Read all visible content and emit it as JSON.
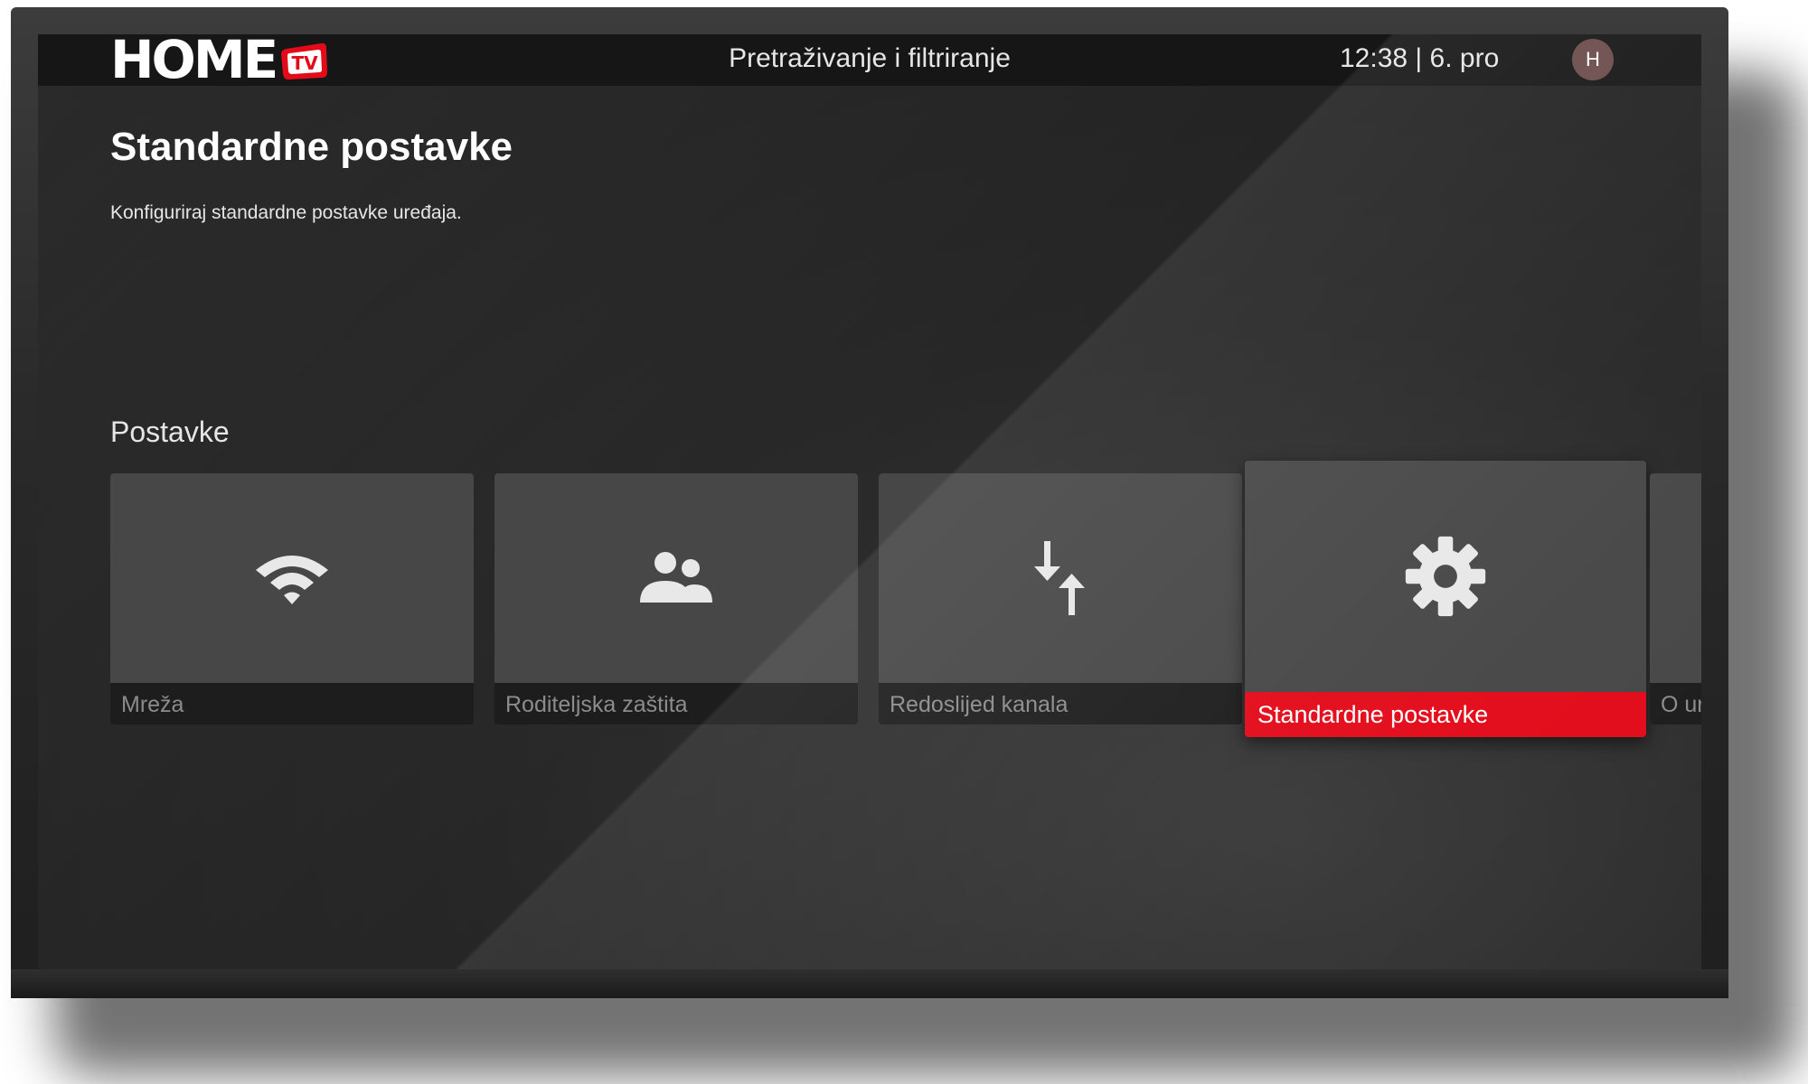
{
  "header": {
    "logo_text": "HOME",
    "logo_badge": "TV",
    "nav_title": "Pretraživanje i filtriranje",
    "clock": "12:38 | 6. pro",
    "avatar_initial": "H"
  },
  "page": {
    "title": "Standardne postavke",
    "subtitle": "Konfiguriraj standardne postavke uređaja."
  },
  "settings": {
    "section_title": "Postavke",
    "tiles": [
      {
        "label": "Mreža",
        "icon": "wifi-icon"
      },
      {
        "label": "Roditeljska zaštita",
        "icon": "people-icon"
      },
      {
        "label": "Redoslijed kanala",
        "icon": "sort-arrows-icon"
      },
      {
        "label": "Standardne postavke",
        "icon": "gear-icon",
        "selected": true
      },
      {
        "label": "O ur",
        "icon": ""
      }
    ]
  },
  "colors": {
    "accent": "#e30b1a",
    "tile": "#474747",
    "background": "#1e1e1e"
  }
}
